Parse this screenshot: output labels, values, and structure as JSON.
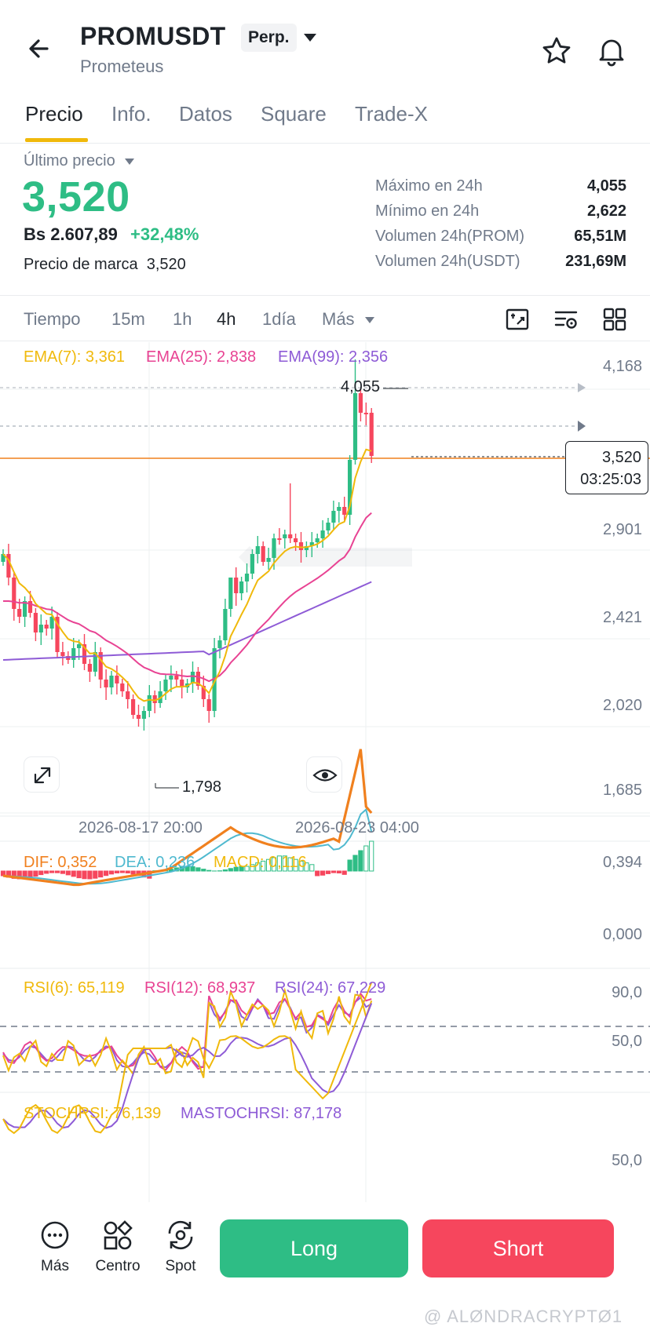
{
  "header": {
    "symbol": "PROMUSDT",
    "contract_type": "Perp.",
    "name": "Prometeus"
  },
  "tabs": [
    "Precio",
    "Info.",
    "Datos",
    "Square",
    "Trade-X"
  ],
  "price": {
    "last_label": "Último precio",
    "last": "3,520",
    "local_price": "Bs 2.607,89",
    "change": "+32,48%",
    "mark_label": "Precio de marca",
    "mark_value": "3,520"
  },
  "stats": [
    {
      "label": "Máximo en 24h",
      "value": "4,055"
    },
    {
      "label": "Mínimo en 24h",
      "value": "2,622"
    },
    {
      "label": "Volumen 24h(PROM)",
      "value": "65,51M"
    },
    {
      "label": "Volumen 24h(USDT)",
      "value": "231,69M"
    }
  ],
  "timeframes": {
    "items": [
      "Tiempo",
      "15m",
      "1h",
      "4h",
      "1día",
      "Más"
    ],
    "active": "4h"
  },
  "ema": {
    "ema7": "EMA(7): 3,361",
    "ema25": "EMA(25): 2,838",
    "ema99": "EMA(99): 2,356"
  },
  "price_axis": [
    "4,168",
    "2,901",
    "2,421",
    "2,020",
    "1,685"
  ],
  "markers": {
    "high": "4,055",
    "low": "1,798",
    "current": "3,520",
    "countdown": "03:25:03"
  },
  "time_axis": [
    "2026-08-17 20:00",
    "2026-08-23 04:00"
  ],
  "macd": {
    "dif": "DIF: 0,352",
    "dea": "DEA: 0,236",
    "macd": "MACD: 0,116",
    "axis": [
      "0,394",
      "0,000"
    ]
  },
  "rsi": {
    "rsi6": "RSI(6): 65,119",
    "rsi12": "RSI(12): 68,937",
    "rsi24": "RSI(24): 67,229",
    "axis": [
      "90,0",
      "50,0"
    ]
  },
  "stochrsi": {
    "stoch": "STOCHRSI: 76,139",
    "ma": "MASTOCHRSI: 87,178",
    "axis": [
      "50,0"
    ]
  },
  "bottom": {
    "more": "Más",
    "center": "Centro",
    "spot": "Spot",
    "long": "Long",
    "short": "Short"
  },
  "watermark": "@ ALØNDRACRYPTØ1",
  "colors": {
    "green": "#2ebd85",
    "red": "#f6465d",
    "ema7": "#f0b90b",
    "ema25": "#e84393",
    "ema99": "#8e5bd6",
    "accent": "#f0b90b",
    "dif": "#f0801e",
    "dea": "#4fb9cf"
  }
}
